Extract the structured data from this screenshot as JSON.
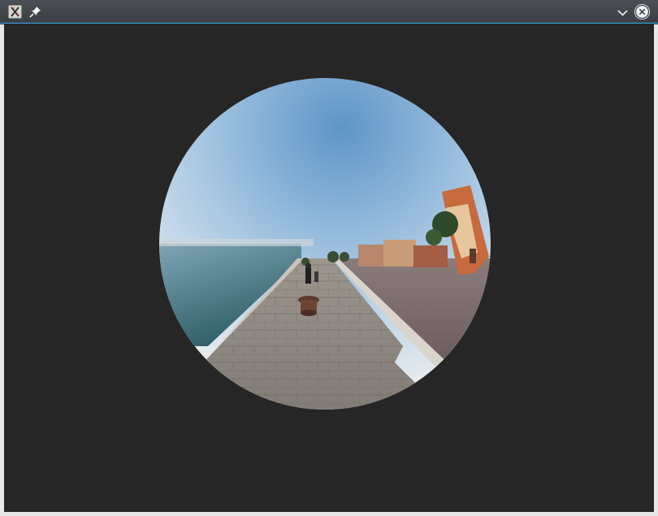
{
  "window": {
    "app_icon": "x-app-icon",
    "pin_icon": "pin-icon",
    "menu_icon": "chevron-down-icon",
    "close_icon": "close-icon",
    "accent_color": "#3daee9",
    "background_color": "#262626"
  },
  "viewer": {
    "image": "fisheye-panorama-photo",
    "scene": "waterfront-promenade-with-bollard-and-buildings"
  }
}
